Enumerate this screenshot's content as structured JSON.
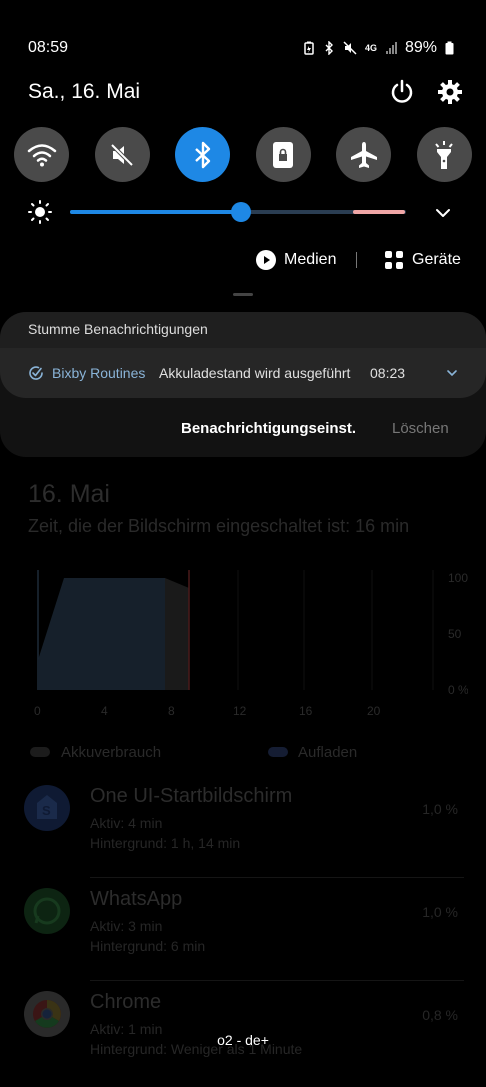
{
  "status_bar": {
    "time": "08:59",
    "network": "4G",
    "battery": "89%"
  },
  "header": {
    "date": "Sa., 16. Mai"
  },
  "quick_tiles": [
    {
      "name": "wifi",
      "active": false
    },
    {
      "name": "mute",
      "active": false
    },
    {
      "name": "bluetooth",
      "active": true
    },
    {
      "name": "lock-screen-rotation",
      "active": false
    },
    {
      "name": "airplane",
      "active": false
    },
    {
      "name": "flashlight",
      "active": false
    }
  ],
  "brightness": {
    "level": 0.51,
    "accent": "#1e88e5"
  },
  "media_row": {
    "media_label": "Medien",
    "devices_label": "Geräte"
  },
  "notification_panel": {
    "title": "Stumme Benachrichtigungen",
    "notification": {
      "app": "Bixby Routines",
      "text": "Akkuladestand wird ausgeführt",
      "time": "08:23"
    },
    "settings_button": "Benachrichtigungseinst.",
    "clear_button": "Löschen"
  },
  "background": {
    "title": "16. Mai",
    "subtitle": "Zeit, die der Bildschirm eingeschaltet ist: 16 min",
    "chart_data": {
      "type": "area",
      "x_ticks": [
        "0",
        "4",
        "8",
        "12",
        "16",
        "20"
      ],
      "y_ticks": [
        "100",
        "50",
        "0 %"
      ],
      "legend": [
        "Akkuverbrauch",
        "Aufladen"
      ]
    },
    "apps": [
      {
        "name": "One UI-Startbildschirm",
        "active": "Aktiv: 4 min",
        "background": "Hintergrund: 1 h, 14 min",
        "percent": "1,0 %"
      },
      {
        "name": "WhatsApp",
        "active": "Aktiv: 3 min",
        "background": "Hintergrund: 6 min",
        "percent": "1,0 %"
      },
      {
        "name": "Chrome",
        "active": "Aktiv: 1 min",
        "background": "Hintergrund: Weniger als 1 Minute",
        "percent": "0,8 %"
      }
    ]
  },
  "carrier": "o2 - de+"
}
